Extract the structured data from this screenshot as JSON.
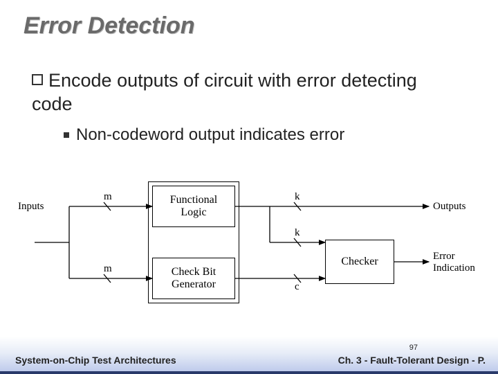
{
  "title": "Error Detection",
  "bullets": {
    "b1": "Encode outputs of circuit with error detecting code",
    "b2": "Non-codeword output indicates error"
  },
  "diagram": {
    "inputs_label": "Inputs",
    "m1": "m",
    "m2": "m",
    "func_logic": "Functional\nLogic",
    "check_gen": "Check Bit\nGenerator",
    "k1": "k",
    "k2": "k",
    "c": "c",
    "checker": "Checker",
    "outputs_label": "Outputs",
    "error_label": "Error\nIndication"
  },
  "footer": {
    "page": "97",
    "left": "System-on-Chip Test Architectures",
    "right": "Ch. 3 - Fault-Tolerant Design - P."
  }
}
